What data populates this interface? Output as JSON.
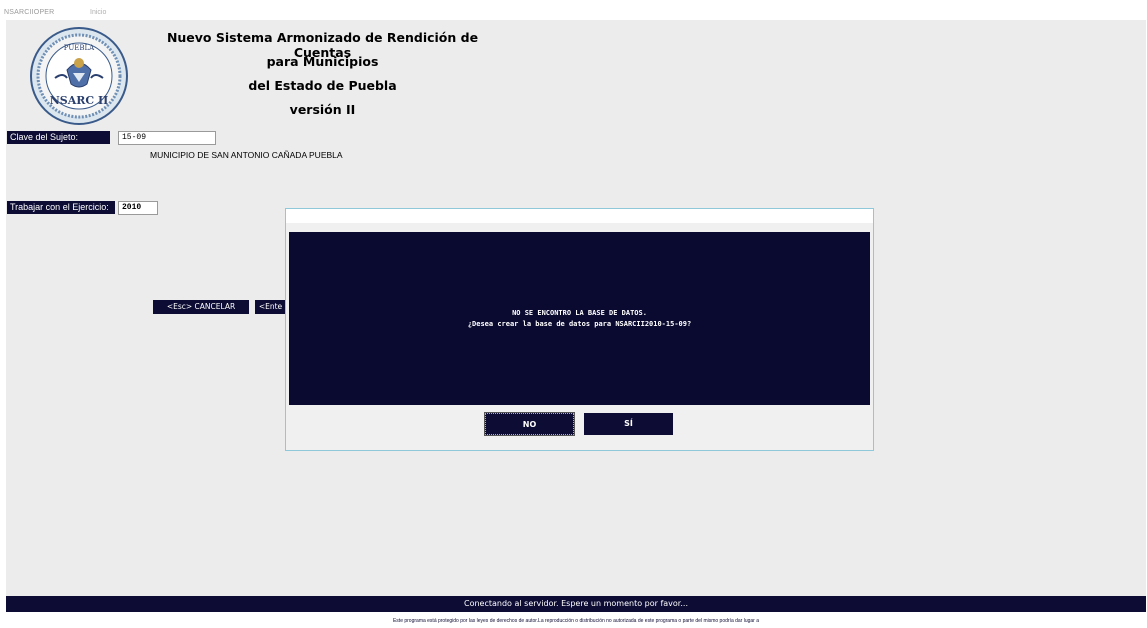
{
  "window": {
    "app_name": "NSARCIIOPER",
    "menu_item": "Inicio"
  },
  "header": {
    "title_lines": [
      "Nuevo Sistema Armonizado de Rendición de Cuentas",
      "para Municipios",
      "del Estado de Puebla",
      "versión II"
    ],
    "logo": {
      "top_text": "PUEBLA",
      "bottom_text": "NSARC II",
      "icon": "state-seal-logo"
    }
  },
  "form": {
    "clave_label": "Clave del Sujeto:",
    "clave_value": "15-09",
    "municipio": "MUNICIPIO DE SAN ANTONIO CAÑADA PUEBLA",
    "ejercicio_label": "Trabajar con el Ejercicio:",
    "ejercicio_value": "2010",
    "cancel_label": "<Esc>  CANCELAR",
    "enter_label": "<Ente"
  },
  "dialog": {
    "line1": "NO SE ENCONTRO LA BASE DE DATOS.",
    "line2": "¿Desea crear la base de datos para NSARCII2010-15-09?",
    "no_label": "NO",
    "yes_label": "SÍ"
  },
  "status": {
    "message": "Conectando al servidor. Espere un momento por favor...",
    "footer": "Este programa está protegido por las leyes de derechos de autor.La reproducción o distribución no autorizada de este programa o parte del mismo podría dar lugar a"
  },
  "colors": {
    "navy": "#0d0c35",
    "panel": "#ececec",
    "dialog_border": "#8fc8d8"
  }
}
